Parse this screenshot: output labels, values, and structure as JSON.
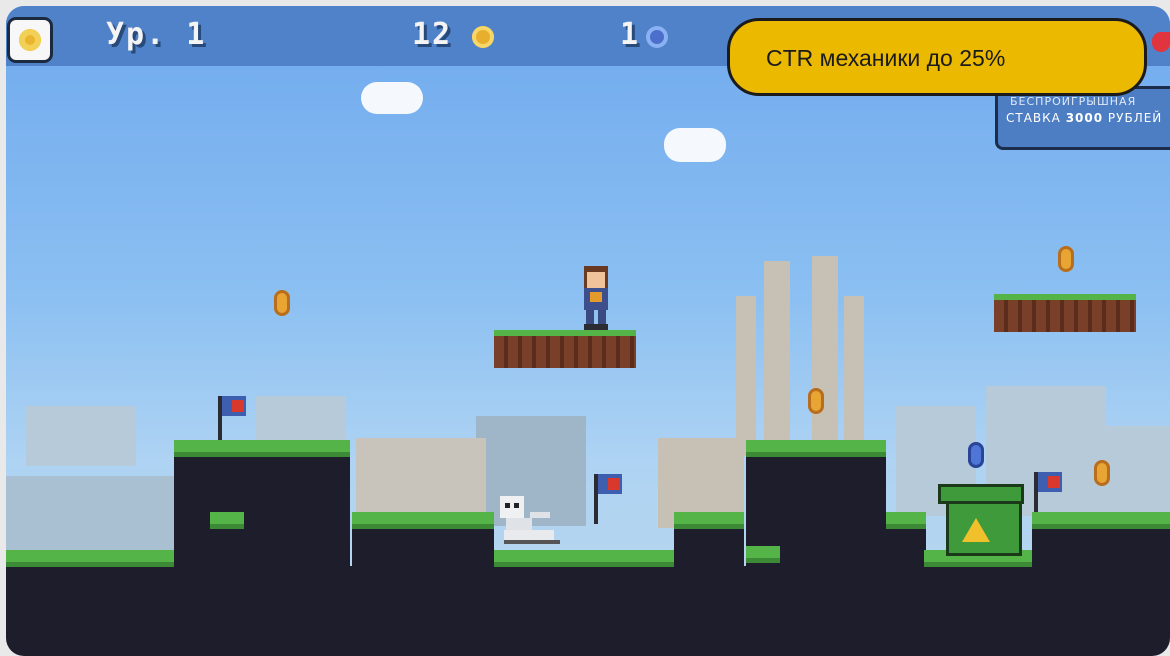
{
  "hud": {
    "level_label": "Ур. 1",
    "coins": "12",
    "gems": "1",
    "coin_icon": "coin-icon",
    "gem_icon": "gem-icon",
    "settings_icon": "gear-icon",
    "lives_icon": "heart-icon"
  },
  "callout": {
    "text": "CTR механики до 25%"
  },
  "banner": {
    "line1": "БЕСПРОИГРЫШНАЯ",
    "line2_prefix": "СТАВКА ",
    "line2_amount": "3000",
    "line2_suffix": " РУБЛЕЙ"
  },
  "colors": {
    "sky_top": "#6fa9ee",
    "hud_bar": "#4f82c9",
    "callout_fill": "#ebb900",
    "grass": "#55b448",
    "coin": "#e8a534",
    "gem": "#4f76d6"
  }
}
